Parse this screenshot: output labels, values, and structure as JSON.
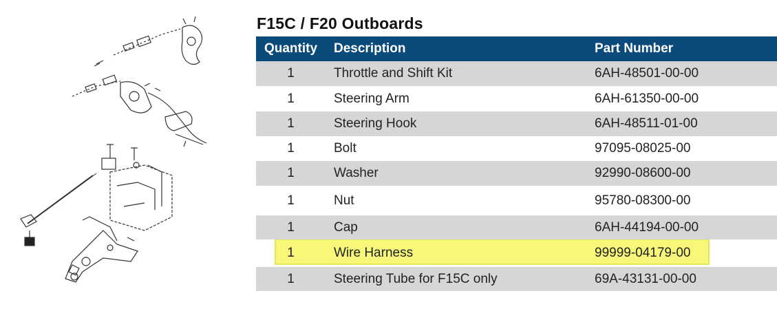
{
  "title": "F15C / F20 Outboards",
  "table": {
    "headers": {
      "quantity": "Quantity",
      "description": "Description",
      "part_number": "Part Number"
    },
    "rows": [
      {
        "quantity": "1",
        "description": "Throttle and Shift Kit",
        "part_number": "6AH-48501-00-00",
        "shaded": true
      },
      {
        "quantity": "1",
        "description": "Steering Arm",
        "part_number": "6AH-61350-00-00",
        "shaded": false
      },
      {
        "quantity": "1",
        "description": "Steering Hook",
        "part_number": "6AH-48511-01-00",
        "shaded": true
      },
      {
        "quantity": "1",
        "description": "Bolt",
        "part_number": "97095-08025-00",
        "shaded": false
      },
      {
        "quantity": "1",
        "description": "Washer",
        "part_number": "92990-08600-00",
        "shaded": true
      },
      {
        "quantity": "1",
        "description": "Nut",
        "part_number": "95780-08300-00",
        "shaded": false
      },
      {
        "quantity": "1",
        "description": "Cap",
        "part_number": "6AH-44194-00-00",
        "shaded": true
      },
      {
        "quantity": "1",
        "description": "Wire Harness",
        "part_number": "99999-04179-00",
        "highlighted": true
      },
      {
        "quantity": "1",
        "description": "Steering Tube for F15C only",
        "part_number": "69A-43131-00-00",
        "shaded": true
      }
    ]
  },
  "colors": {
    "header_bg": "#0a4b7c",
    "row_shade": "#d6d6d6",
    "highlight": "#f7f77a"
  }
}
